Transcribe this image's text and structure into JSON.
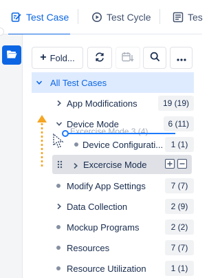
{
  "tabs": [
    {
      "label": "Test Case",
      "icon": "test-case-icon",
      "active": true
    },
    {
      "label": "Test Cycle",
      "icon": "test-cycle-icon",
      "active": false
    },
    {
      "label": "Tes",
      "icon": "test-plan-icon",
      "active": false
    }
  ],
  "rail": {
    "icon": "folder-open-icon"
  },
  "toolbar": {
    "new_folder_label": "Fold...",
    "new_folder_icon": "plus-icon",
    "refresh_icon": "refresh-icon",
    "archive_icon": "calendar-archive-icon",
    "search_icon": "search-icon",
    "more_icon": "more-horizontal-icon"
  },
  "tree": {
    "root_label": "All Test Cases",
    "items": [
      {
        "label": "App Modifications",
        "count": "19 (19)",
        "kind": "folder-collapsed"
      },
      {
        "label": "Device Mode",
        "count": "6 (11)",
        "kind": "folder-expanded"
      },
      {
        "label": "Device Configurati...",
        "count": "1 (1)",
        "kind": "leaf"
      },
      {
        "label": "Modify App Settings",
        "count": "7 (7)",
        "kind": "leaf"
      },
      {
        "label": "Data Collection",
        "count": "2 (9)",
        "kind": "folder-collapsed"
      },
      {
        "label": "Mockup Programs",
        "count": "2 (2)",
        "kind": "leaf"
      },
      {
        "label": "Resources",
        "count": "7 (7)",
        "kind": "leaf"
      },
      {
        "label": "Resource Utilization",
        "count": "1 (1)",
        "kind": "leaf"
      }
    ],
    "dragging": {
      "label": "Excercise Mode",
      "ghost_label": "Excercise Mode",
      "ghost_count": "3 (4)"
    }
  },
  "colors": {
    "accent": "#0c66e4",
    "selected_bg": "#deebff",
    "drag_bg": "#dfe1e6",
    "drop_line": "#1d7afc",
    "drag_arrow": "#f5a623"
  }
}
